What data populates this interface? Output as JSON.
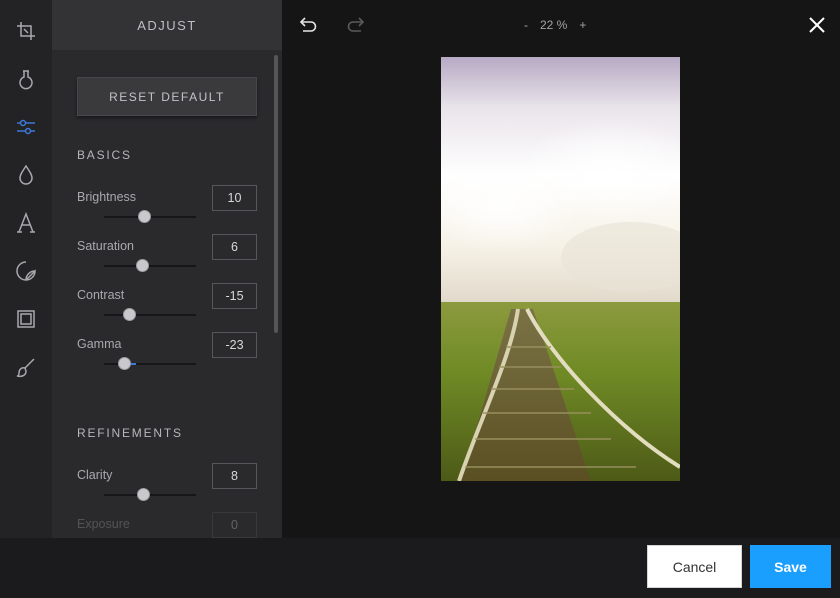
{
  "panel": {
    "title": "ADJUST",
    "reset_label": "RESET DEFAULT",
    "sections": [
      {
        "title": "BASICS",
        "sliders": [
          {
            "label": "Brightness",
            "value": "10"
          },
          {
            "label": "Saturation",
            "value": "6"
          },
          {
            "label": "Contrast",
            "value": "-15"
          },
          {
            "label": "Gamma",
            "value": "-23"
          }
        ]
      },
      {
        "title": "REFINEMENTS",
        "sliders": [
          {
            "label": "Clarity",
            "value": "8"
          },
          {
            "label": "Exposure",
            "value": "0"
          }
        ]
      }
    ]
  },
  "rail": {
    "icons": [
      "crop-icon",
      "filter-icon",
      "adjust-sliders-icon",
      "drop-icon",
      "text-icon",
      "sticker-icon",
      "frame-icon",
      "brush-icon"
    ],
    "active_icon": "adjust-sliders-icon",
    "accent_color": "#3d78d8"
  },
  "canvas": {
    "zoom_minus": "-",
    "zoom_level": "22 %",
    "zoom_plus": "+"
  },
  "footer": {
    "cancel_label": "Cancel",
    "save_label": "Save",
    "save_color": "#1a9fff"
  }
}
